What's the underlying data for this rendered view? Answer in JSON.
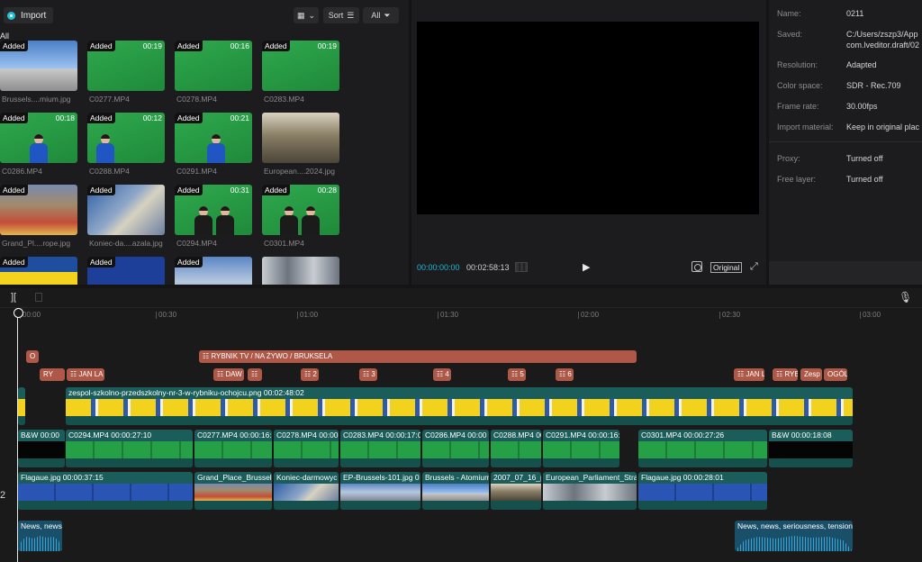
{
  "media": {
    "import_label": "Import",
    "sort_label": "Sort",
    "all_label": "All",
    "filter_all": "All",
    "added_label": "Added",
    "items": [
      {
        "name": "Brussels....mium.jpg",
        "duration": "",
        "style": "sky"
      },
      {
        "name": "C0277.MP4",
        "duration": "00:19",
        "style": "green"
      },
      {
        "name": "C0278.MP4",
        "duration": "00:16",
        "style": "green"
      },
      {
        "name": "C0283.MP4",
        "duration": "00:19",
        "style": "green"
      },
      {
        "name": "C0286.MP4",
        "duration": "00:18",
        "style": "green-person"
      },
      {
        "name": "C0288.MP4",
        "duration": "00:12",
        "style": "green-person"
      },
      {
        "name": "C0291.MP4",
        "duration": "00:21",
        "style": "green-person"
      },
      {
        "name": "European....2024.jpg",
        "duration": "",
        "style": "hall"
      },
      {
        "name": "Grand_Pl....rope.jpg",
        "duration": "",
        "style": "square"
      },
      {
        "name": "Koniec-da....azala.jpg",
        "duration": "",
        "style": "flags"
      },
      {
        "name": "C0294.MP4",
        "duration": "00:31",
        "style": "green-duo"
      },
      {
        "name": "C0301.MP4",
        "duration": "00:28",
        "style": "green-duo"
      }
    ]
  },
  "player": {
    "time_current": "00:00:00:00",
    "time_total": "00:02:58:13",
    "play_icon": "▶",
    "original_label": "Original",
    "fullscreen_icon": "⤢"
  },
  "details": [
    {
      "label": "Name:",
      "value": "0211"
    },
    {
      "label": "Saved:",
      "value": "C:/Users/zszp3/App"
    },
    {
      "label": "",
      "value": "com.lveditor.draft/02"
    },
    {
      "label": "Resolution:",
      "value": "Adapted"
    },
    {
      "label": "Color space:",
      "value": "SDR - Rec.709"
    },
    {
      "label": "Frame rate:",
      "value": "30.00fps"
    },
    {
      "label": "Import material:",
      "value": "Keep in original plac"
    },
    {
      "label": "Proxy:",
      "value": "Turned off"
    },
    {
      "label": "Free layer:",
      "value": "Turned off"
    }
  ],
  "timeline": {
    "ruler": [
      "00:00",
      "00:30",
      "01:00",
      "01:30",
      "02:00",
      "02:30",
      "03:00"
    ],
    "track_label": "2",
    "text_clips": [
      {
        "label": "O",
        "row": 0
      },
      {
        "label": "☷ RYBNIK TV / NA ŻYWO / BRUKSELA",
        "row": 0
      },
      {
        "label": "RY",
        "row": 1
      },
      {
        "label": "☷ JAN LA",
        "row": 1
      },
      {
        "label": "☷ DAW",
        "row": 1
      },
      {
        "label": "☷",
        "row": 1
      },
      {
        "label": "☷ 2",
        "row": 1
      },
      {
        "label": "☷ 3",
        "row": 1
      },
      {
        "label": "☷ 4",
        "row": 1
      },
      {
        "label": "☷ 5",
        "row": 1
      },
      {
        "label": "☷ 6",
        "row": 1
      },
      {
        "label": "☷ JAN L",
        "row": 1
      },
      {
        "label": "☷ RYB",
        "row": 1
      },
      {
        "label": "Zesp",
        "row": 1
      },
      {
        "label": "OGÓL",
        "row": 1
      }
    ],
    "overlay_clip": {
      "label": "zespol-szkolno-przedszkolny-nr-3-w-rybniku-ochojcu.png  00:02:48:02"
    },
    "main_clips": [
      {
        "label": "B&W  00:00"
      },
      {
        "label": "C0294.MP4  00:00:27:10"
      },
      {
        "label": "C0277.MP4  00:00:16:"
      },
      {
        "label": "C0278.MP4  00:00"
      },
      {
        "label": "C0283.MP4  00:00:17:0"
      },
      {
        "label": "C0286.MP4  00:00"
      },
      {
        "label": "C0288.MP4  00:00"
      },
      {
        "label": "C0291.MP4  00:00:16:2"
      },
      {
        "label": "C0301.MP4  00:00:27:26"
      },
      {
        "label": "B&W  00:00:18:08"
      }
    ],
    "image_clips": [
      {
        "label": "Flagaue.jpg  00:00:37:15"
      },
      {
        "label": "Grand_Place_Brussels"
      },
      {
        "label": "Koniec-darmowyc"
      },
      {
        "label": "EP-Brussels-101.jpg  0"
      },
      {
        "label": "Brussels - Atomium"
      },
      {
        "label": "2007_07_16_p"
      },
      {
        "label": "European_Parliament_Stras"
      },
      {
        "label": "Flagaue.jpg  00:00:28:01"
      }
    ],
    "audio_clips": [
      {
        "label": "News, news,"
      },
      {
        "label": "News, news, seriousness, tension(1"
      }
    ]
  }
}
